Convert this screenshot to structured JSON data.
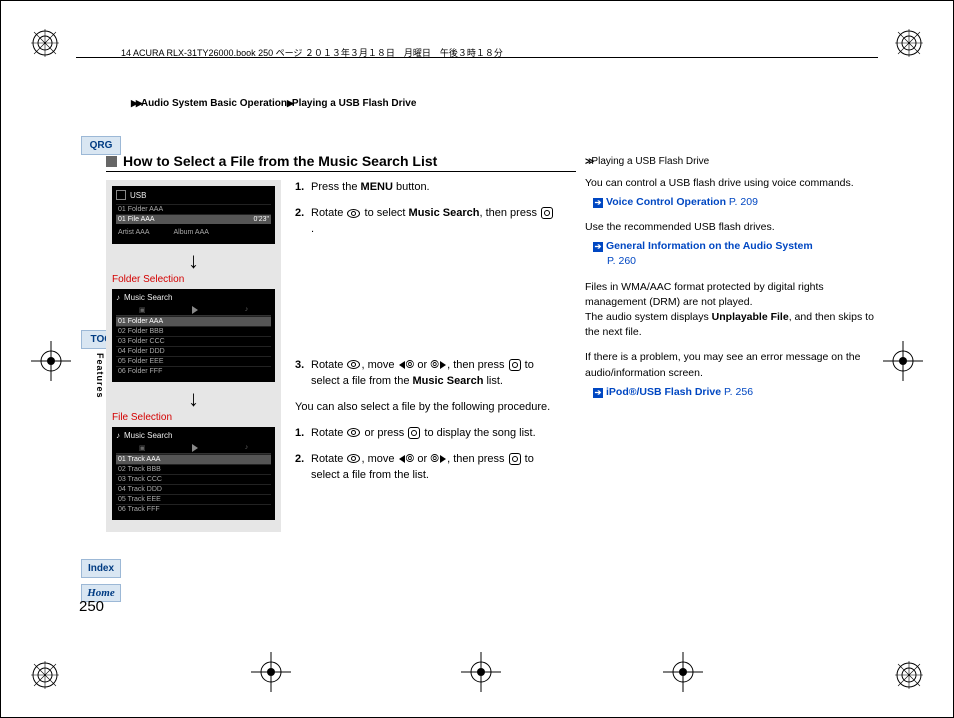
{
  "header": {
    "doc_line": "14 ACURA RLX-31TY26000.book  250 ページ  ２０１３年３月１８日　月曜日　午後３時１８分"
  },
  "breadcrumb": {
    "a": "Audio System Basic Operation",
    "b": "Playing a USB Flash Drive"
  },
  "sidebar": {
    "qrg": "QRG",
    "toc": "TOC",
    "index": "Index",
    "home": "Home",
    "features": "Features"
  },
  "section": {
    "title": "How to Select a File from the Music Search List"
  },
  "shots": {
    "usb_title": "USB",
    "usb_rows": {
      "r1": "01  Folder AAA",
      "r2": "01 File AAA",
      "r3": "Artist AAA",
      "r4": "Album AAA",
      "time": "0'23\""
    },
    "folder_label": "Folder Selection",
    "ms_title": "Music Search",
    "folders": {
      "f1": "01 Folder AAA",
      "f2": "02 Folder BBB",
      "f3": "03 Folder CCC",
      "f4": "04 Folder DDD",
      "f5": "05 Folder EEE",
      "f6": "06 Folder FFF"
    },
    "file_label": "File Selection",
    "tracks": {
      "t1": "01 Track AAA",
      "t2": "02 Track BBB",
      "t3": "03 Track CCC",
      "t4": "04 Track DDD",
      "t5": "05 Track EEE",
      "t6": "06 Track FFF"
    }
  },
  "steps": {
    "s1a": "Press the ",
    "s1b": "MENU",
    "s1c": " button.",
    "s2a": "Rotate ",
    "s2b": " to select ",
    "s2c": "Music Search",
    "s2d": ", then press ",
    "s2e": ".",
    "s3a": "Rotate ",
    "s3b": ", move ",
    "s3c": " or ",
    "s3d": ", then press ",
    "s3e": " to select a file from the ",
    "s3f": "Music Search",
    "s3g": " list.",
    "para1": "You can also select a file by the following procedure.",
    "s4a": "Rotate ",
    "s4b": " or press ",
    "s4c": " to display the song list.",
    "s5a": "Rotate ",
    "s5b": ", move ",
    "s5c": " or ",
    "s5d": ", then press ",
    "s5e": " to select a file from the list."
  },
  "aside": {
    "title": "Playing a USB Flash Drive",
    "p1": "You can control a USB flash drive using voice commands.",
    "l1": "Voice Control Operation",
    "l1p": "P. 209",
    "p2": "Use the recommended USB flash drives.",
    "l2": "General Information on the Audio System",
    "l2p": "P. 260",
    "p3a": "Files in WMA/AAC format protected by digital rights management (DRM) are not played.",
    "p3b": "The audio system displays ",
    "p3c": "Unplayable File",
    "p3d": ", and then skips to the next file.",
    "p4": "If there is a problem, you may see an error message on the audio/information screen.",
    "l3": "iPod®/USB Flash Drive",
    "l3p": "P. 256"
  },
  "num": {
    "n1": "1.",
    "n2": "2.",
    "n3": "3."
  },
  "page": {
    "num": "250"
  }
}
